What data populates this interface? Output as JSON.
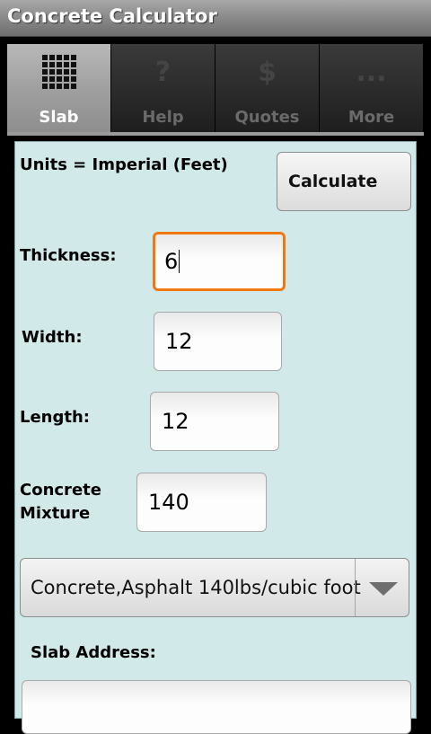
{
  "app": {
    "title": "Concrete Calculator"
  },
  "tabs": [
    {
      "label": "Slab",
      "icon": "grid-icon",
      "selected": true
    },
    {
      "label": "Help",
      "icon": "?",
      "selected": false
    },
    {
      "label": "Quotes",
      "icon": "$",
      "selected": false
    },
    {
      "label": "More",
      "icon": "...",
      "selected": false
    }
  ],
  "form": {
    "units_label": "Units = Imperial (Feet)",
    "calculate_label": "Calculate",
    "thickness": {
      "label": "Thickness:",
      "value": "6"
    },
    "width": {
      "label": "Width:",
      "value": "12"
    },
    "length": {
      "label": "Length:",
      "value": "12"
    },
    "mixture": {
      "label_line1": "Concrete",
      "label_line2": "Mixture",
      "value": "140"
    },
    "mixture_select": {
      "selected": "Concrete,Asphalt 140lbs/cubic foot"
    },
    "address": {
      "label": "Slab Address:",
      "value": ""
    }
  },
  "colors": {
    "panel_bg": "#d2e9e9",
    "focus": "#f07810"
  }
}
